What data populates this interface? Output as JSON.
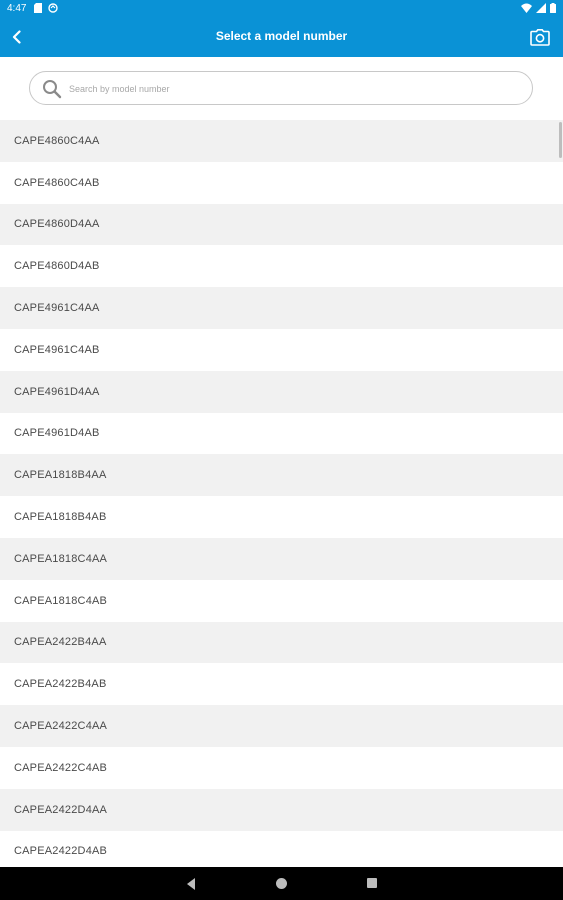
{
  "status_bar": {
    "time": "4:47",
    "left_icons": [
      "sd-card-icon",
      "sync-icon"
    ],
    "right_icons": [
      "wifi-icon",
      "signal-icon",
      "battery-icon"
    ]
  },
  "app_bar": {
    "title": "Select a model number",
    "back_icon": "chevron-left-icon",
    "camera_icon": "camera-icon"
  },
  "search": {
    "placeholder": "Search by model number",
    "value": ""
  },
  "models": [
    "CAPE4860C4AA",
    "CAPE4860C4AB",
    "CAPE4860D4AA",
    "CAPE4860D4AB",
    "CAPE4961C4AA",
    "CAPE4961C4AB",
    "CAPE4961D4AA",
    "CAPE4961D4AB",
    "CAPEA1818B4AA",
    "CAPEA1818B4AB",
    "CAPEA1818C4AA",
    "CAPEA1818C4AB",
    "CAPEA2422B4AA",
    "CAPEA2422B4AB",
    "CAPEA2422C4AA",
    "CAPEA2422C4AB",
    "CAPEA2422D4AA",
    "CAPEA2422D4AB"
  ],
  "colors": {
    "accent": "#0a92d6",
    "row_alt": "#f1f1f1",
    "text": "#4a4a4a"
  }
}
